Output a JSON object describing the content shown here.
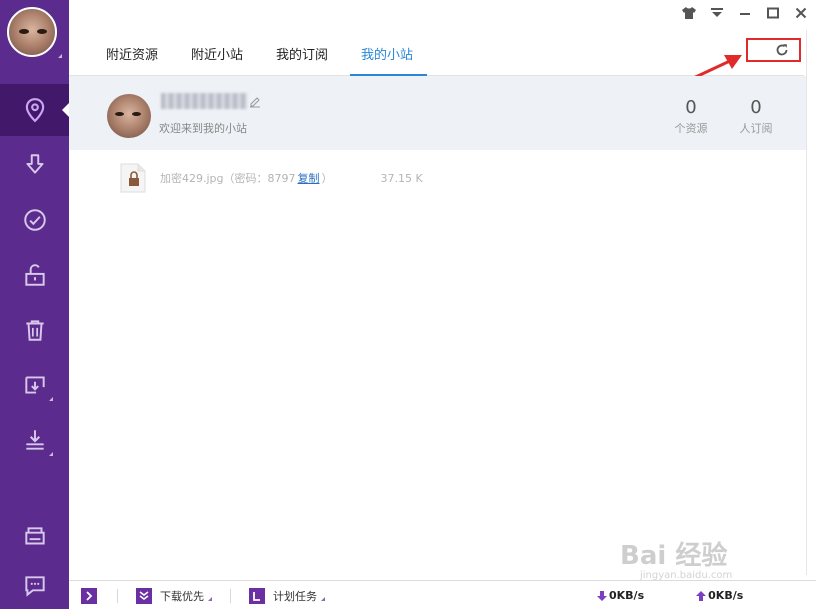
{
  "window": {
    "controls": [
      "skin-icon",
      "menu-icon",
      "minimize-icon",
      "maximize-icon",
      "close-icon"
    ]
  },
  "tabs": [
    {
      "label": "附近资源"
    },
    {
      "label": "附近小站"
    },
    {
      "label": "我的订阅"
    },
    {
      "label": "我的小站"
    }
  ],
  "active_tab": "我的小站",
  "profile": {
    "welcome": "欢迎来到我的小站",
    "resources_count": "0",
    "resources_label": "个资源",
    "subscribers_count": "0",
    "subscribers_label": "人订阅"
  },
  "files": [
    {
      "name": "加密429.jpg（密码：8797",
      "copy_label": "复制",
      "close_paren": "）",
      "size": "37.15 K"
    }
  ],
  "statusbar": {
    "download_priority": "下载优先",
    "scheduled_task": "计划任务",
    "down_speed": "0KB/s",
    "up_speed": "0KB/s"
  },
  "watermark": {
    "text": "Bai 经验",
    "url": "jingyan.baidu.com"
  },
  "colors": {
    "sidebar": "#5b2b8e",
    "sidebar_active": "#42186a",
    "accent": "#2a86d8",
    "highlight": "#e02b2b"
  }
}
